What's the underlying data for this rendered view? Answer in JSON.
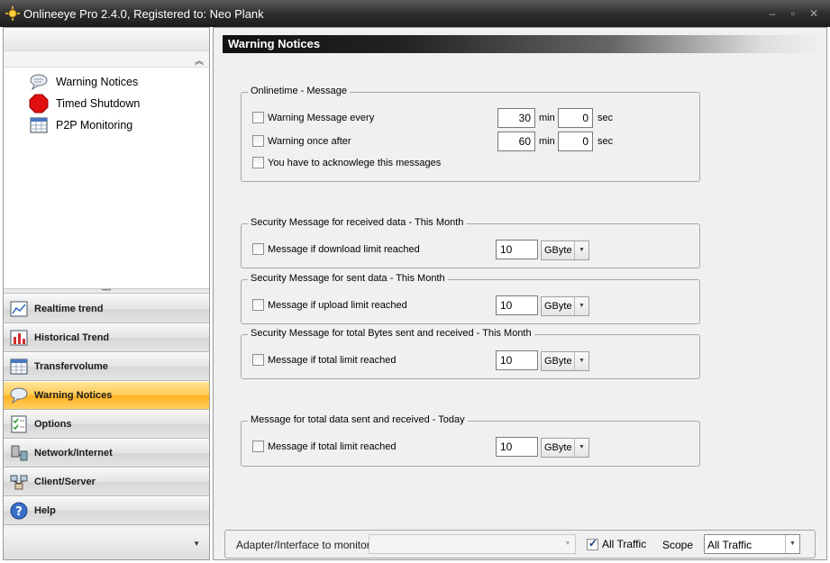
{
  "window": {
    "title": "Onlineeye Pro 2.4.0, Registered to: Neo Plank",
    "minimize_icon": "minimize-icon",
    "maximize_icon": "maximize-icon",
    "close_icon": "close-icon"
  },
  "sidebar": {
    "tree_items": [
      {
        "label": "Warning Notices",
        "icon": "warning-notices-icon"
      },
      {
        "label": "Timed Shutdown",
        "icon": "stop-sign-icon"
      },
      {
        "label": "P2P Monitoring",
        "icon": "calendar-grid-icon"
      }
    ],
    "nav_items": [
      {
        "label": "Realtime trend",
        "icon": "chart-icon"
      },
      {
        "label": "Historical Trend",
        "icon": "bar-chart-icon"
      },
      {
        "label": "Transfervolume",
        "icon": "calendar-grid-icon"
      },
      {
        "label": "Warning Notices",
        "icon": "warning-notices-icon",
        "active": true
      },
      {
        "label": "Options",
        "icon": "checklist-icon"
      },
      {
        "label": "Network/Internet",
        "icon": "network-icon"
      },
      {
        "label": "Client/Server",
        "icon": "client-server-icon"
      },
      {
        "label": "Help",
        "icon": "help-icon"
      }
    ]
  },
  "main": {
    "title": "Warning Notices",
    "onlinetime": {
      "legend": "Onlinetime - Message",
      "row1_label": "Warning Message every",
      "row1_min": "30",
      "row1_sec": "0",
      "row2_label": "Warning once after",
      "row2_min": "60",
      "row2_sec": "0",
      "ack_label": "You have to acknowlege this messages",
      "min_unit": "min",
      "sec_unit": "sec"
    },
    "received": {
      "legend": "Security Message for received data - This Month",
      "label": "Message if download limit reached",
      "value": "10",
      "unit": "GByte"
    },
    "sent": {
      "legend": "Security Message for sent data - This Month",
      "label": "Message if upload limit reached",
      "value": "10",
      "unit": "GByte"
    },
    "total_month": {
      "legend": "Security Message for total Bytes sent and received - This Month",
      "label": "Message if total limit reached",
      "value": "10",
      "unit": "GByte"
    },
    "total_today": {
      "legend": "Message for total data sent and received - Today",
      "label": "Message if total limit reached",
      "value": "10",
      "unit": "GByte"
    }
  },
  "footer": {
    "adapter_label": "Adapter/Interface to monitor",
    "adapter_value": "",
    "all_traffic_label": "All Traffic",
    "scope_label": "Scope",
    "scope_value": "All Traffic"
  }
}
